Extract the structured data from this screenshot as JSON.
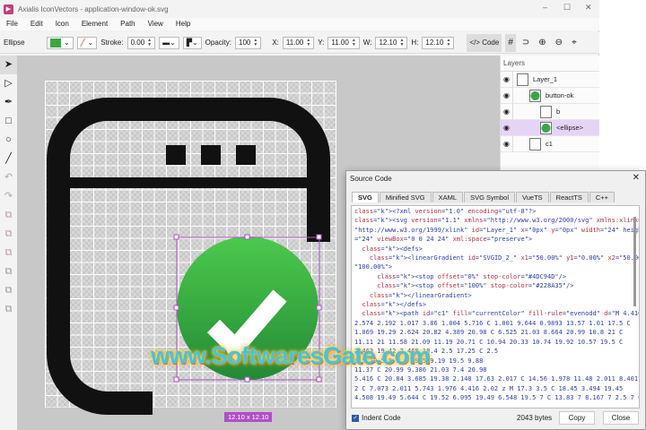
{
  "app": {
    "title": "Axialis IconVectors - application-window-ok.svg",
    "logo_letter": "▶"
  },
  "menu": [
    "File",
    "Edit",
    "Icon",
    "Element",
    "Path",
    "View",
    "Help"
  ],
  "toolbar": {
    "element_type": "Ellipse",
    "fill_color": "#3aa846",
    "stroke_label": "Stroke:",
    "stroke_value": "0.00",
    "opacity_label": "Opacity:",
    "opacity_value": "100",
    "x_label": "X:",
    "x_value": "11.00",
    "y_label": "Y:",
    "y_value": "11.00",
    "w_label": "W:",
    "w_value": "12.10",
    "h_label": "H:",
    "h_value": "12.10",
    "code_label": "Code"
  },
  "tools": [
    "select",
    "direct-select",
    "pen",
    "rectangle",
    "ellipse",
    "line",
    "undo",
    "redo",
    "combine-1",
    "combine-2",
    "combine-3",
    "combine-4",
    "combine-5",
    "combine-6"
  ],
  "canvas": {
    "size_label": "12.10 x 12.10",
    "accent": "#b04fc4"
  },
  "layers": {
    "title": "Layers",
    "items": [
      {
        "name": "Layer_1"
      },
      {
        "name": "button-ok"
      },
      {
        "name": "b"
      },
      {
        "name": "<ellipse>",
        "selected": true
      },
      {
        "name": "c1"
      }
    ]
  },
  "dialog": {
    "title": "Source Code",
    "tabs": [
      "SVG",
      "Minified SVG",
      "XAML",
      "SVG Symbol",
      "VueTS",
      "ReactTS",
      "C++"
    ],
    "active_tab": "SVG",
    "code": [
      "<?xml version=\"1.0\" encoding=\"utf-8\"?>",
      "<svg version=\"1.1\" xmlns=\"http://www.w3.org/2000/svg\" xmlns:xlink=",
      "\"http://www.w3.org/1999/xlink\" id=\"Layer_1\" x=\"0px\" y=\"0px\" width=\"24\" height",
      "=\"24\" viewBox=\"0 0 24 24\" xml:space=\"preserve\">",
      "  <defs>",
      "    <linearGradient id=\"SVGID_2_\" x1=\"50.00%\" y1=\"0.00%\" x2=\"50.00%\" y2=",
      "\"100.00%\">",
      "      <stop offset=\"0%\" stop-color=\"#4DC94D\"/>",
      "      <stop offset=\"100%\" stop-color=\"#228A35\"/>",
      "    </linearGradient>",
      "  </defs>",
      "  <path id=\"c1\" fill=\"currentColor\" fill-rule=\"evenodd\" d=\"M 4.416 2.02 C",
      "2.574 2.192 1.017 3.86 1.004 5.716 C 1.001 9.644 0.9893 13.57 1.01 17.5 C",
      "1.069 19.29 2.624 20.82 4.389 20.98 C 6.525 21.03 8.664 20.99 10.8 21 C",
      "11.11 21 11.58 21.09 11.19 20.71 C 10.94 20.33 10.74 19.92 10.57 19.5 C",
      "7.463 19.42 2.468 18.4 2.5 17.25 C 2.5",
      "8.5 19.5 8.5 C 19.5 9.19 19.5 9.88",
      "11.37 C 20.99 9.386 21.03 7.4 20.98",
      "5.416 C 20.84 3.685 19.38 2.148 17.63 2.017 C 14.56 1.978 11.48 2.011 8.401",
      "2 C 7.073 2.011 5.743 1.976 4.416 2.02 z M 17.3 3.5 C 18.45 3.494 19.45",
      "4.508 19.49 5.644 C 19.52 6.095 19.49 6.548 19.5 7 C 13.83 7 8.167 7 2.5 7 C"
    ],
    "indent_label": "Indent Code",
    "indent_checked": true,
    "bytes": "2043 bytes",
    "copy_label": "Copy",
    "close_label": "Close"
  },
  "watermark": "www.SoftwaresGate.com"
}
